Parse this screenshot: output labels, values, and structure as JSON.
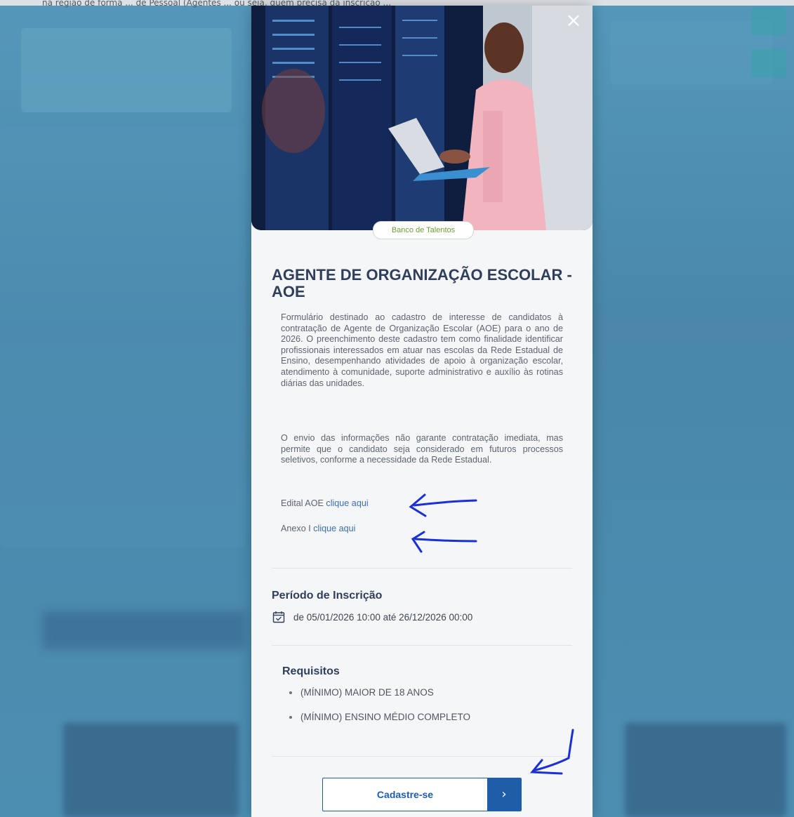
{
  "background": {
    "top_strip_text": "na região de forma ... de Pessoal (Agentes ... ou seja, quem precisa da inscrição ..."
  },
  "modal": {
    "close_icon": "×",
    "badge": "Banco de Talentos",
    "title": "AGENTE DE ORGANIZAÇÃO ESCOLAR - AOE",
    "description_1": "Formulário destinado ao cadastro de interesse de candidatos à contratação de Agente de Organização Escolar (AOE) para o ano de 2026. O preenchimento deste cadastro tem como finalidade identificar profissionais interessados em atuar nas escolas da Rede Estadual de Ensino, desempenhando atividades de apoio à organização escolar, atendimento à comunidade, suporte administrativo e auxílio às rotinas diárias das unidades.",
    "description_2": "O envio das informações não garante contratação imediata, mas permite que o candidato seja considerado em futuros processos seletivos, conforme a necessidade da Rede Estadual.",
    "links": [
      {
        "prefix": "Edital AOE ",
        "link_text": "clique aqui"
      },
      {
        "prefix": "Anexo I ",
        "link_text": "clique aqui"
      }
    ],
    "period": {
      "title": "Período de Inscrição",
      "value": "de 05/01/2026 10:00 até 26/12/2026 00:00",
      "icon": "calendar-check-icon"
    },
    "requirements": {
      "title": "Requisitos",
      "items": [
        "(MÍNIMO) MAIOR DE 18 ANOS",
        "(MÍNIMO) ENSINO MÉDIO COMPLETO"
      ]
    },
    "cta": {
      "label": "Cadastre-se",
      "arrow": "›"
    }
  },
  "colors": {
    "accent": "#1e5ea8",
    "title": "#2f3e5a",
    "badge_text": "#6ba035",
    "annotation": "#1b2fd6"
  }
}
